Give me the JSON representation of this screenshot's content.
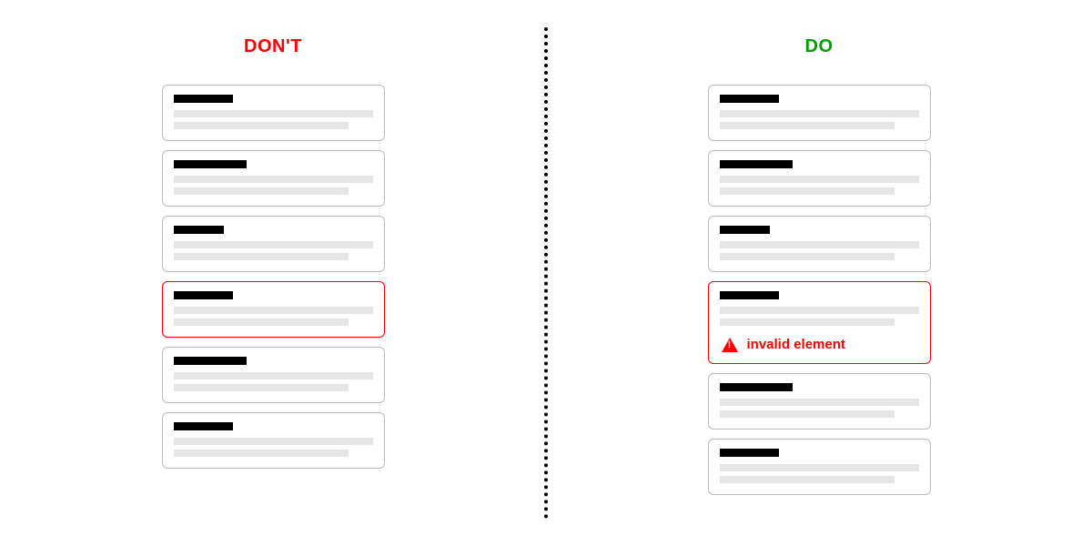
{
  "headings": {
    "dont": "DON'T",
    "do": "DO"
  },
  "error_message": "invalid element",
  "colors": {
    "dont": "#ff0000",
    "do": "#00a000",
    "error": "#ff0000"
  },
  "panels": {
    "dont": {
      "cards": [
        {
          "error": false
        },
        {
          "error": false
        },
        {
          "error": false
        },
        {
          "error": true,
          "show_message": false
        },
        {
          "error": false
        },
        {
          "error": false
        }
      ]
    },
    "do": {
      "cards": [
        {
          "error": false
        },
        {
          "error": false
        },
        {
          "error": false
        },
        {
          "error": true,
          "show_message": true
        },
        {
          "error": false
        },
        {
          "error": false
        }
      ]
    }
  }
}
